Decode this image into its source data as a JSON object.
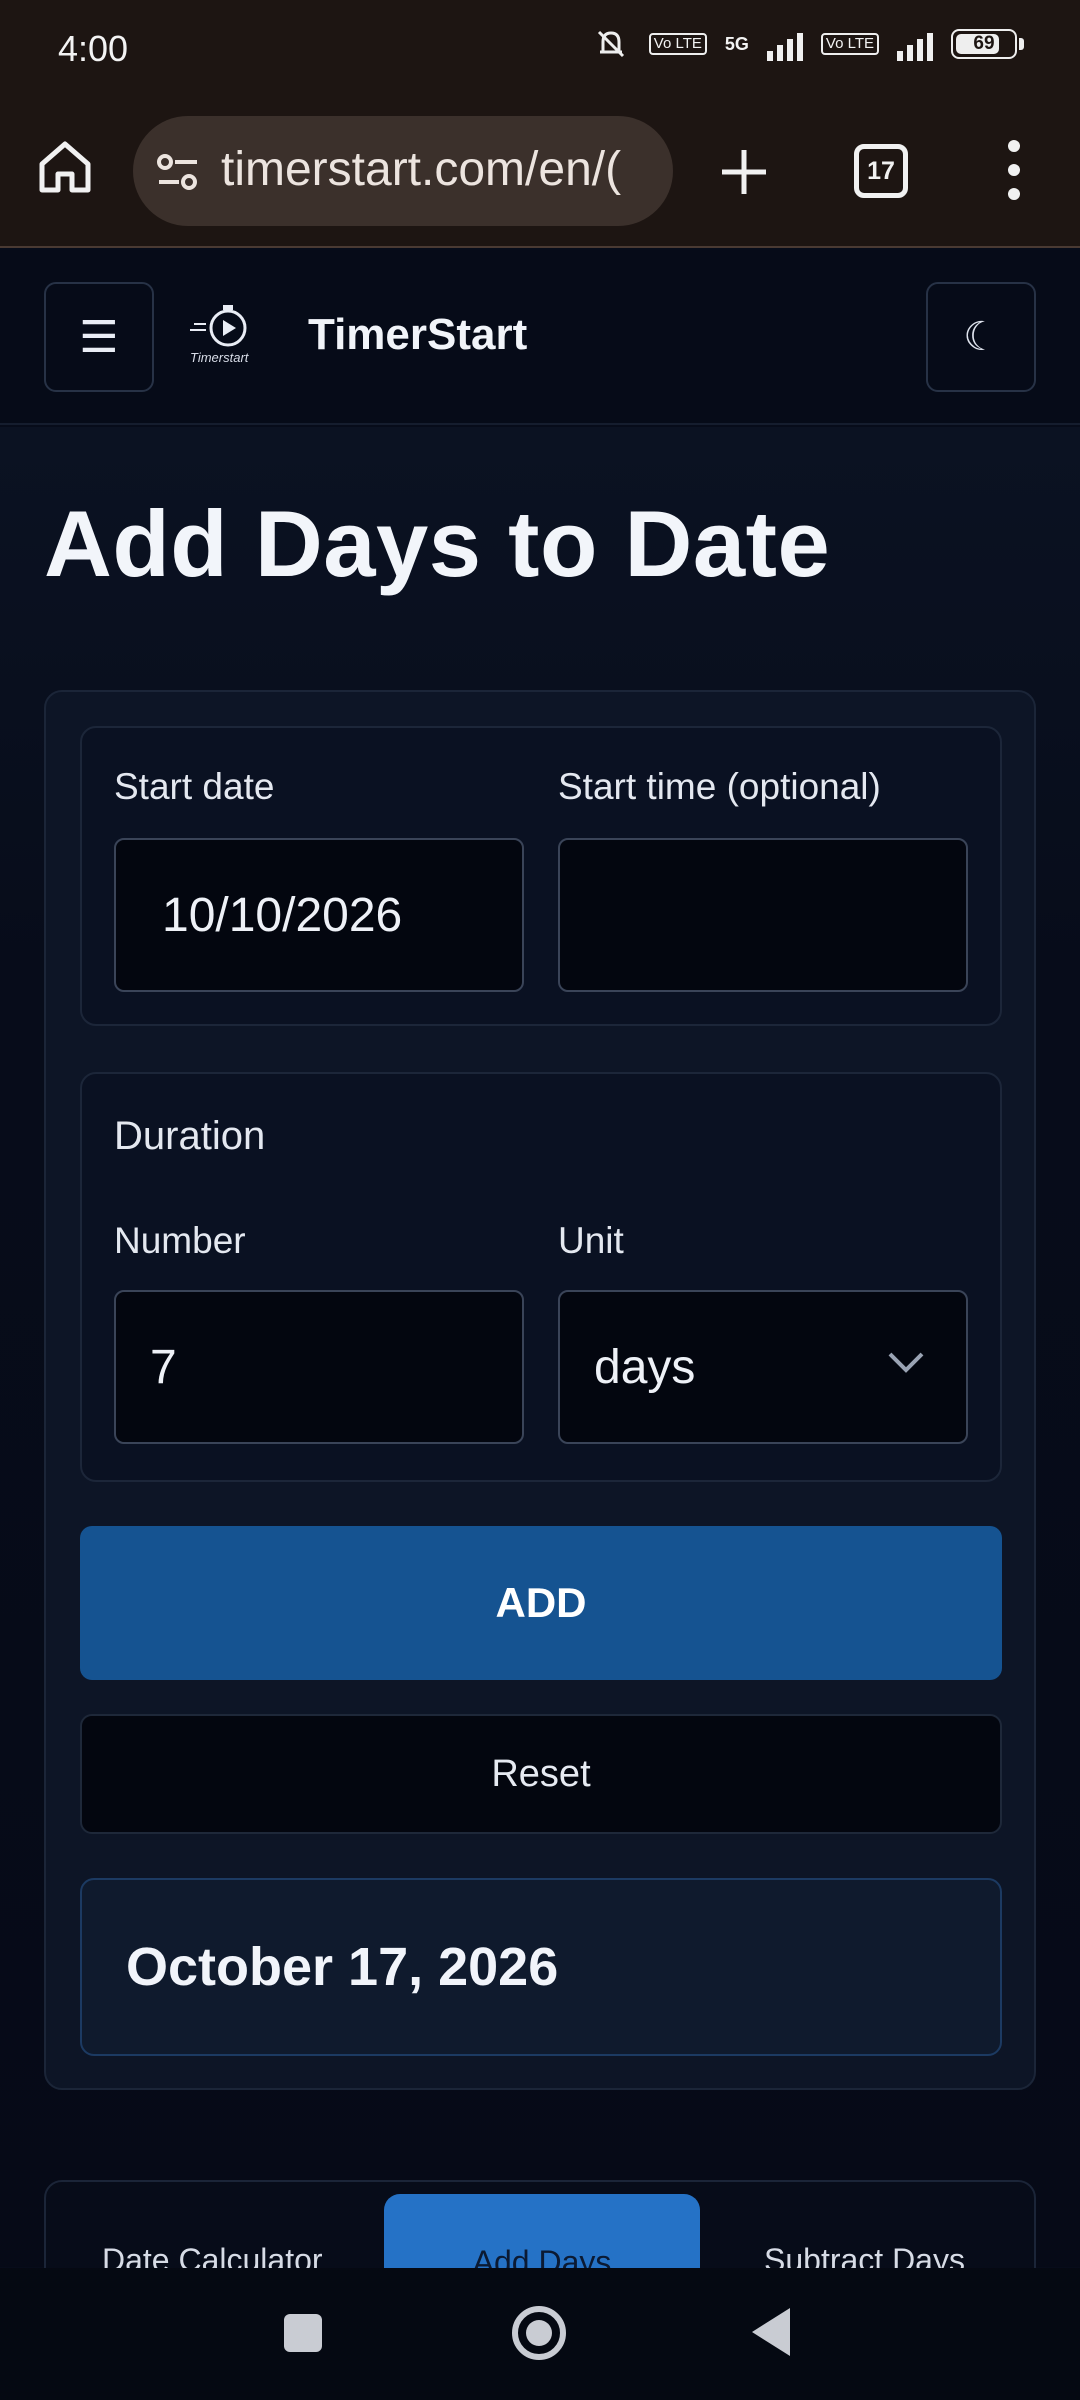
{
  "status": {
    "time": "4:00",
    "battery": "69",
    "network_label": "5G",
    "volte_label": "Vo LTE"
  },
  "browser": {
    "url": "timerstart.com/en/(",
    "tab_count": "17",
    "icons": [
      "home-icon",
      "site-info-icon",
      "plus-icon",
      "tabs-icon",
      "more-icon"
    ]
  },
  "header": {
    "menu_glyph": "☰",
    "logo_caption": "Timerstart",
    "site_name": "TimerStart",
    "theme_glyph": "☾"
  },
  "page": {
    "title": "Add Days to Date"
  },
  "form": {
    "start_date_label": "Start date",
    "start_date_value": "10/10/2026",
    "start_time_label": "Start time (optional)",
    "start_time_value": "",
    "duration_heading": "Duration",
    "number_label": "Number",
    "number_value": "7",
    "unit_label": "Unit",
    "unit_value": "days",
    "add_label": "ADD",
    "reset_label": "Reset",
    "result": "October 17, 2026"
  },
  "tabs": {
    "items": [
      "Date Calculator",
      "Add Days",
      "Subtract Days"
    ],
    "active": "Add Days"
  },
  "colors": {
    "accent": "#155391",
    "active_tab": "#2572c6",
    "background": "#070c1a"
  }
}
